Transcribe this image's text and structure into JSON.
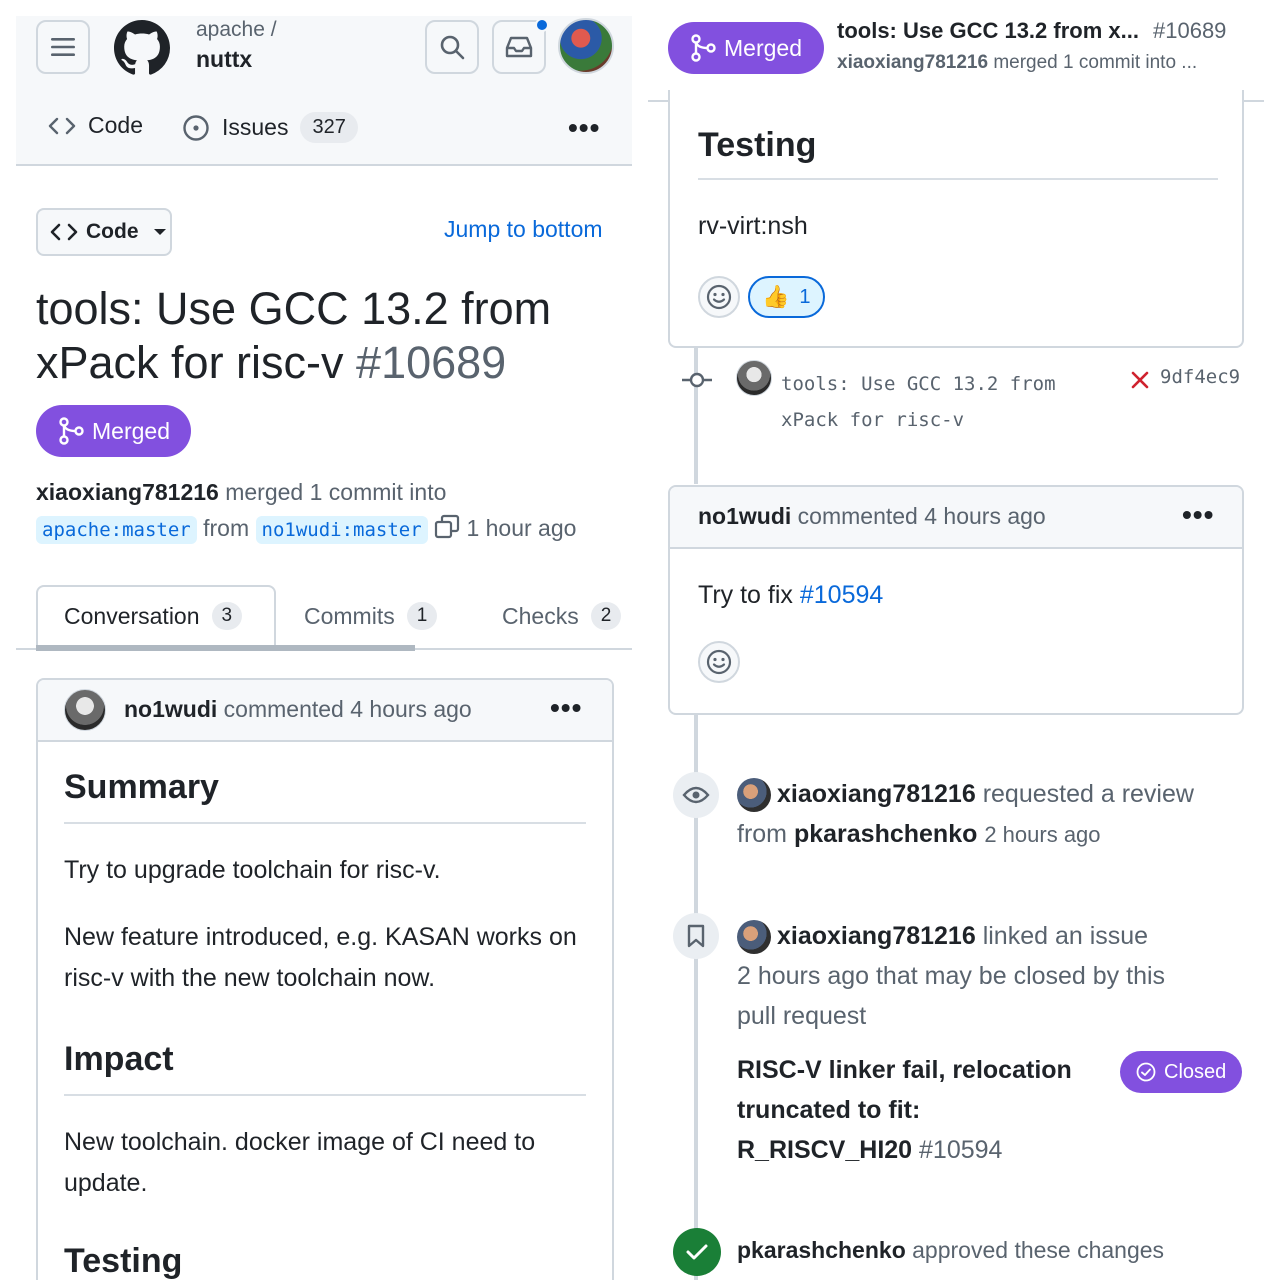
{
  "left": {
    "repo": {
      "owner": "apache /",
      "name": "nuttx"
    },
    "nav": {
      "code_label": "Code",
      "issues_label": "Issues",
      "issues_count": "327",
      "more": "•••"
    },
    "file_button": {
      "label": "Code"
    },
    "jump_link": "Jump to bottom",
    "pr": {
      "title": "tools: Use GCC 13.2 from xPack for risc-v",
      "number": "#10689",
      "status": "Merged",
      "author": "xiaoxiang781216",
      "merge_text": "merged 1 commit into",
      "base_branch": "apache:master",
      "from_text": "from",
      "head_branch": "no1wudi:master",
      "time": "1 hour ago"
    },
    "tabs": [
      {
        "label": "Conversation",
        "count": "3"
      },
      {
        "label": "Commits",
        "count": "1"
      },
      {
        "label": "Checks",
        "count": "2"
      }
    ],
    "comment": {
      "author": "no1wudi",
      "meta": "commented 4 hours ago",
      "more": "•••",
      "h_summary": "Summary",
      "p1": "Try to upgrade toolchain for risc-v.",
      "p2": "New feature introduced, e.g. KASAN works on risc-v with the new toolchain now.",
      "h_impact": "Impact",
      "p3": "New toolchain. docker image of CI need to update.",
      "h_testing": "Testing"
    }
  },
  "right": {
    "sticky": {
      "status": "Merged",
      "title": "tools: Use GCC 13.2 from x...",
      "number": "#10689",
      "author": "xiaoxiang781216",
      "sub": "merged 1 commit into ..."
    },
    "testing_card": {
      "heading": "Testing",
      "text": "rv-virt:nsh",
      "thumbs_count": "1"
    },
    "commit": {
      "message_line1": "tools: Use GCC 13.2 from",
      "message_line2": "xPack for risc-v",
      "sha": "9df4ec9"
    },
    "comment2": {
      "author": "no1wudi",
      "meta": "commented 4 hours ago",
      "more": "•••",
      "text": "Try to fix",
      "link": "#10594"
    },
    "event_review": {
      "actor": "xiaoxiang781216",
      "text": "requested a review",
      "from": "from",
      "reviewer": "pkarashchenko",
      "time": "2 hours ago"
    },
    "event_link": {
      "actor": "xiaoxiang781216",
      "text": "linked an issue",
      "line2": "2 hours ago that may be closed by this",
      "line3": "pull request",
      "issue_title_1": "RISC-V linker fail, relocation",
      "issue_title_2": "truncated to fit:",
      "issue_title_3": "R_RISCV_HI20",
      "issue_number": "#10594",
      "issue_status": "Closed"
    },
    "event_approve": {
      "actor": "pkarashchenko",
      "text": "approved these changes"
    }
  },
  "colors": {
    "merged_purple": "#8250df",
    "link_blue": "#0969da",
    "success_green": "#1a7f37",
    "fail_red": "#cf222e"
  }
}
